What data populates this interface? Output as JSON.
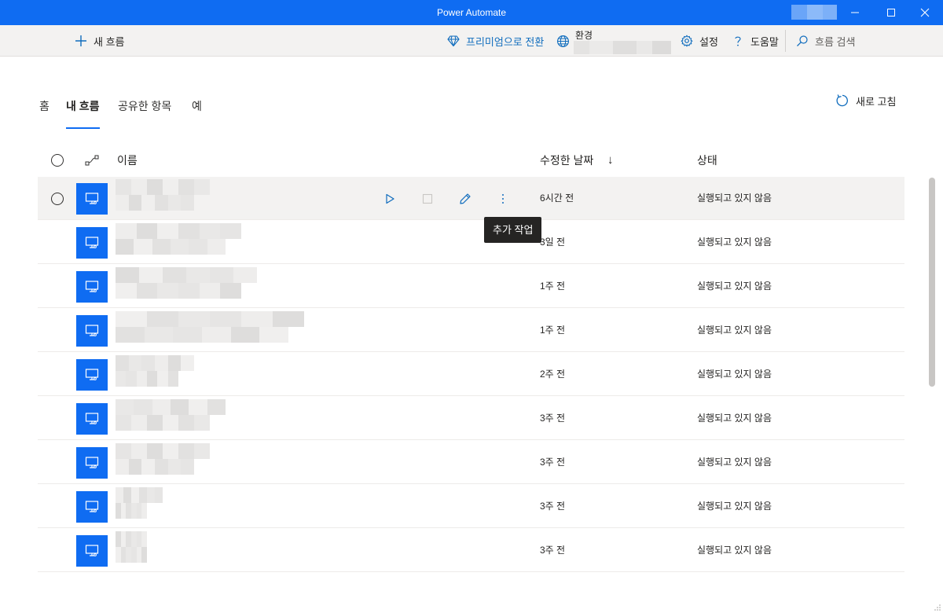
{
  "colors": {
    "accent": "#0f6cf2",
    "premium_text": "#0f6cbd"
  },
  "window": {
    "title": "Power Automate"
  },
  "toolbar": {
    "new_flow": "새 흐름",
    "premium": "프리미엄으로 전환",
    "environment_label": "환경",
    "settings": "설정",
    "help": "도움말",
    "search_placeholder": "흐름 검색"
  },
  "tabs": [
    {
      "label": "홈",
      "active": false
    },
    {
      "label": "내 흐름",
      "active": true
    },
    {
      "label": "공유한 항목",
      "active": false
    },
    {
      "label": "예",
      "active": false
    }
  ],
  "refresh_label": "새로 고침",
  "list": {
    "columns": {
      "name": "이름",
      "modified": "수정한 날짜",
      "status": "상태",
      "sort_indicator": "↓"
    },
    "rows": [
      {
        "modified": "6시간 전",
        "status": "실행되고 있지 않음",
        "hovered": true
      },
      {
        "modified": "3일 전",
        "status": "실행되고 있지 않음"
      },
      {
        "modified": "1주 전",
        "status": "실행되고 있지 않음"
      },
      {
        "modified": "1주 전",
        "status": "실행되고 있지 않음"
      },
      {
        "modified": "2주 전",
        "status": "실행되고 있지 않음"
      },
      {
        "modified": "3주 전",
        "status": "실행되고 있지 않음"
      },
      {
        "modified": "3주 전",
        "status": "실행되고 있지 않음"
      },
      {
        "modified": "3주 전",
        "status": "실행되고 있지 않음"
      },
      {
        "modified": "3주 전",
        "status": "실행되고 있지 않음"
      }
    ]
  },
  "tooltip": {
    "text": "추가 작업"
  },
  "icons": {
    "titlebar": [
      "minimize-icon",
      "maximize-icon",
      "close-icon"
    ],
    "toolbar": [
      "plus-icon",
      "diamond-icon",
      "globe-icon",
      "gear-icon",
      "question-icon",
      "search-icon"
    ],
    "row_actions": [
      "play-icon",
      "stop-icon",
      "pencil-icon",
      "more-vertical-icon"
    ],
    "row": "desktop-flow-icon"
  }
}
